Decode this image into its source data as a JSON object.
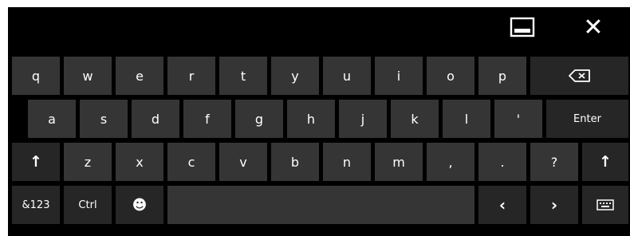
{
  "title_bar": {
    "dock_icon": "dock-minimize-icon",
    "close_icon": "close-icon",
    "close_glyph": "✕"
  },
  "rows": {
    "row1": [
      "q",
      "w",
      "e",
      "r",
      "t",
      "y",
      "u",
      "i",
      "o",
      "p"
    ],
    "row1_backspace_icon": "backspace-icon",
    "row2": [
      "a",
      "s",
      "d",
      "f",
      "g",
      "h",
      "j",
      "k",
      "l",
      "'"
    ],
    "row2_enter": "Enter",
    "row3_shift_glyph": "↑",
    "row3": [
      "z",
      "x",
      "c",
      "v",
      "b",
      "n",
      "m",
      ",",
      ".",
      "?"
    ],
    "row4_symbols": "&123",
    "row4_ctrl": "Ctrl",
    "row4_emoji_glyph": "☻",
    "row4_left_glyph": "‹",
    "row4_right_glyph": "›",
    "row4_keyboard_icon": "keyboard-icon"
  },
  "colors": {
    "background": "#000000",
    "key": "#353535",
    "key_dark": "#262626",
    "text": "#ffffff"
  }
}
